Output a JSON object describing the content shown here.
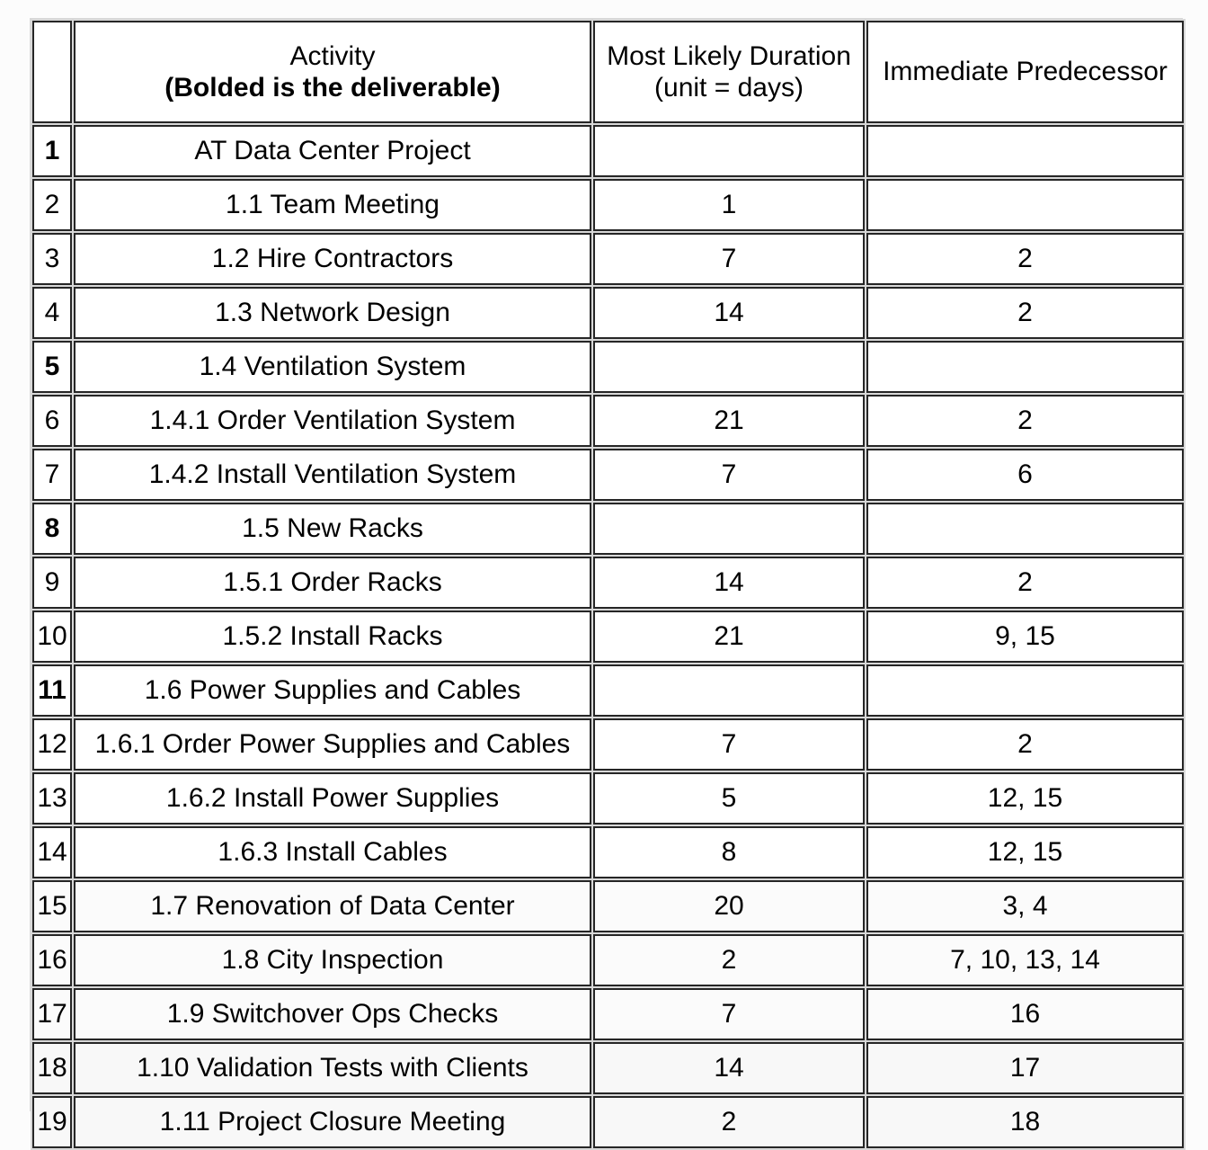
{
  "document": {
    "kind": "project-wbs-table",
    "background_color": "#fcfcfc",
    "border_color": "#262626",
    "frame_color": "#d8d8d8"
  },
  "table": {
    "headers": {
      "index": "",
      "activity_line1": "Activity",
      "activity_line2": "(Bolded is the deliverable)",
      "duration_line1": "Most Likely Duration",
      "duration_line2": "(unit = days)",
      "predecessor": "Immediate Predecessor"
    },
    "rows": [
      {
        "index": "1",
        "activity": "AT Data Center Project",
        "duration": "",
        "predecessor": "",
        "bold": true
      },
      {
        "index": "2",
        "activity": "1.1 Team Meeting",
        "duration": "1",
        "predecessor": "",
        "bold": false
      },
      {
        "index": "3",
        "activity": "1.2 Hire Contractors",
        "duration": "7",
        "predecessor": "2",
        "bold": false
      },
      {
        "index": "4",
        "activity": "1.3 Network Design",
        "duration": "14",
        "predecessor": "2",
        "bold": false
      },
      {
        "index": "5",
        "activity": "1.4 Ventilation System",
        "duration": "",
        "predecessor": "",
        "bold": true
      },
      {
        "index": "6",
        "activity": "1.4.1 Order Ventilation System",
        "duration": "21",
        "predecessor": "2",
        "bold": false
      },
      {
        "index": "7",
        "activity": "1.4.2 Install Ventilation System",
        "duration": "7",
        "predecessor": "6",
        "bold": false
      },
      {
        "index": "8",
        "activity": "1.5 New Racks",
        "duration": "",
        "predecessor": "",
        "bold": true
      },
      {
        "index": "9",
        "activity": "1.5.1 Order Racks",
        "duration": "14",
        "predecessor": "2",
        "bold": false
      },
      {
        "index": "10",
        "activity": "1.5.2 Install Racks",
        "duration": "21",
        "predecessor": "9, 15",
        "bold": false
      },
      {
        "index": "11",
        "activity": "1.6 Power Supplies and Cables",
        "duration": "",
        "predecessor": "",
        "bold": true
      },
      {
        "index": "12",
        "activity": "1.6.1 Order Power Supplies and Cables",
        "duration": "7",
        "predecessor": "2",
        "bold": false
      },
      {
        "index": "13",
        "activity": "1.6.2 Install Power Supplies",
        "duration": "5",
        "predecessor": "12, 15",
        "bold": false
      },
      {
        "index": "14",
        "activity": "1.6.3 Install Cables",
        "duration": "8",
        "predecessor": "12, 15",
        "bold": false
      },
      {
        "index": "15",
        "activity": "1.7 Renovation of Data Center",
        "duration": "20",
        "predecessor": "3, 4",
        "bold": false
      },
      {
        "index": "16",
        "activity": "1.8 City Inspection",
        "duration": "2",
        "predecessor": "7, 10, 13, 14",
        "bold": false
      },
      {
        "index": "17",
        "activity": "1.9 Switchover Ops Checks",
        "duration": "7",
        "predecessor": "16",
        "bold": false
      },
      {
        "index": "18",
        "activity": "1.10 Validation Tests with Clients",
        "duration": "14",
        "predecessor": "17",
        "bold": false
      },
      {
        "index": "19",
        "activity": "1.11 Project Closure Meeting",
        "duration": "2",
        "predecessor": "18",
        "bold": false
      }
    ]
  }
}
